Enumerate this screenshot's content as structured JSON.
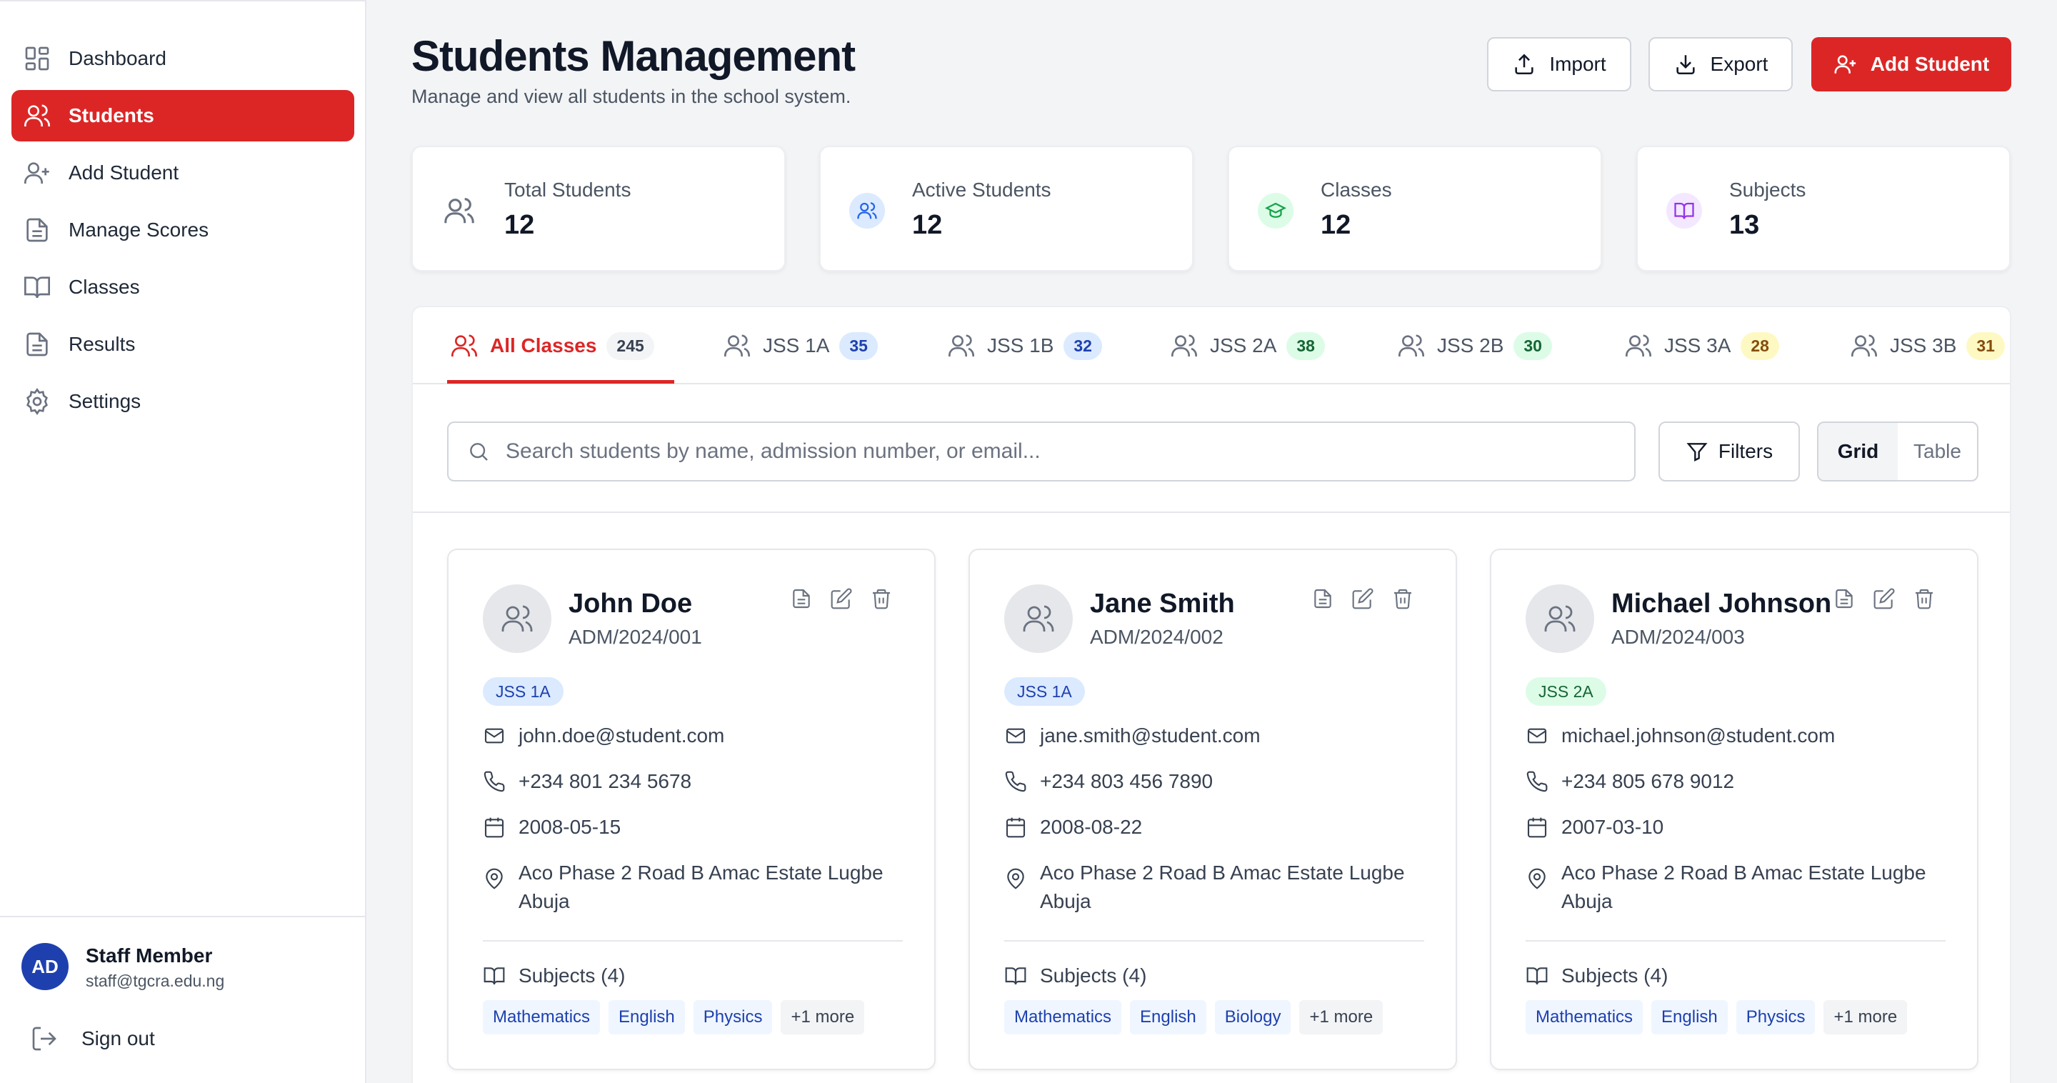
{
  "sidebar": {
    "items": [
      {
        "label": "Dashboard",
        "icon": "dashboard-icon"
      },
      {
        "label": "Students",
        "icon": "users-icon",
        "active": true
      },
      {
        "label": "Add Student",
        "icon": "user-plus-icon"
      },
      {
        "label": "Manage Scores",
        "icon": "document-icon"
      },
      {
        "label": "Classes",
        "icon": "book-icon"
      },
      {
        "label": "Results",
        "icon": "document-icon"
      },
      {
        "label": "Settings",
        "icon": "gear-icon"
      }
    ],
    "user": {
      "initials": "AD",
      "name": "Staff Member",
      "email": "staff@tgcra.edu.ng"
    },
    "signout_label": "Sign out"
  },
  "header": {
    "title": "Students Management",
    "subtitle": "Manage and view all students in the school system.",
    "import_label": "Import",
    "export_label": "Export",
    "add_label": "Add Student"
  },
  "stats": [
    {
      "label": "Total Students",
      "value": "12",
      "icon": "users-icon"
    },
    {
      "label": "Active Students",
      "value": "12",
      "icon": "users-icon"
    },
    {
      "label": "Classes",
      "value": "12",
      "icon": "graduation-cap-icon"
    },
    {
      "label": "Subjects",
      "value": "13",
      "icon": "book-icon"
    }
  ],
  "tabs": [
    {
      "label": "All Classes",
      "count": "245",
      "active": true
    },
    {
      "label": "JSS 1A",
      "count": "35"
    },
    {
      "label": "JSS 1B",
      "count": "32"
    },
    {
      "label": "JSS 2A",
      "count": "38"
    },
    {
      "label": "JSS 2B",
      "count": "30"
    },
    {
      "label": "JSS 3A",
      "count": "28"
    },
    {
      "label": "JSS 3B",
      "count": "31"
    }
  ],
  "search": {
    "placeholder": "Search students by name, admission number, or email..."
  },
  "filters_label": "Filters",
  "view": {
    "grid_label": "Grid",
    "table_label": "Table",
    "selected": "Grid"
  },
  "students": [
    {
      "name": "John Doe",
      "admission": "ADM/2024/001",
      "class": "JSS 1A",
      "email": "john.doe@student.com",
      "phone": "+234 801 234 5678",
      "dob": "2008-05-15",
      "address": "Aco Phase 2 Road B Amac Estate Lugbe Abuja",
      "subjects_label": "Subjects (4)",
      "subjects": [
        "Mathematics",
        "English",
        "Physics"
      ],
      "more": "+1 more"
    },
    {
      "name": "Jane Smith",
      "admission": "ADM/2024/002",
      "class": "JSS 1A",
      "email": "jane.smith@student.com",
      "phone": "+234 803 456 7890",
      "dob": "2008-08-22",
      "address": "Aco Phase 2 Road B Amac Estate Lugbe Abuja",
      "subjects_label": "Subjects (4)",
      "subjects": [
        "Mathematics",
        "English",
        "Biology"
      ],
      "more": "+1 more"
    },
    {
      "name": "Michael Johnson",
      "admission": "ADM/2024/003",
      "class": "JSS 2A",
      "email": "michael.johnson@student.com",
      "phone": "+234 805 678 9012",
      "dob": "2007-03-10",
      "address": "Aco Phase 2 Road B Amac Estate Lugbe Abuja",
      "subjects_label": "Subjects (4)",
      "subjects": [
        "Mathematics",
        "English",
        "Physics"
      ],
      "more": "+1 more"
    }
  ],
  "colors": {
    "accent": "#dc2626",
    "blue_badge_bg": "#dbeafe",
    "blue_badge_fg": "#1e40af",
    "green_badge_bg": "#dcfce7",
    "green_badge_fg": "#166534",
    "yellow_badge_bg": "#fef9c3",
    "yellow_badge_fg": "#854d0e",
    "purple_icon_bg": "#f3e8ff"
  }
}
